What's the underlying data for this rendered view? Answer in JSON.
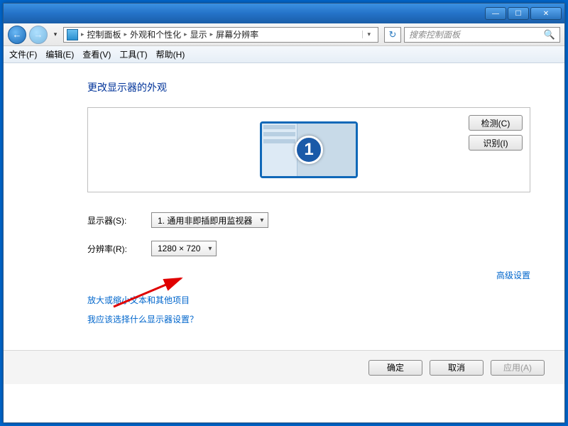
{
  "titlebar": {
    "min": "—",
    "max": "☐",
    "close": "✕"
  },
  "nav": {
    "back": "←",
    "fwd": "→",
    "crumbs": [
      "控制面板",
      "外观和个性化",
      "显示",
      "屏幕分辨率"
    ],
    "refresh": "↻",
    "search_placeholder": "搜索控制面板"
  },
  "menu": {
    "file": "文件(F)",
    "edit": "编辑(E)",
    "view": "查看(V)",
    "tools": "工具(T)",
    "help": "帮助(H)"
  },
  "main": {
    "heading": "更改显示器的外观",
    "monitor_number": "1",
    "detect": "检测(C)",
    "identify": "识别(I)",
    "display_label": "显示器(S):",
    "display_value": "1. 通用非即插即用监视器",
    "resolution_label": "分辨率(R):",
    "resolution_value": "1280 × 720",
    "advanced": "高级设置",
    "link_textsize": "放大或缩小文本和其他项目",
    "link_whichsettings": "我应该选择什么显示器设置？"
  },
  "footer": {
    "ok": "确定",
    "cancel": "取消",
    "apply": "应用(A)"
  }
}
